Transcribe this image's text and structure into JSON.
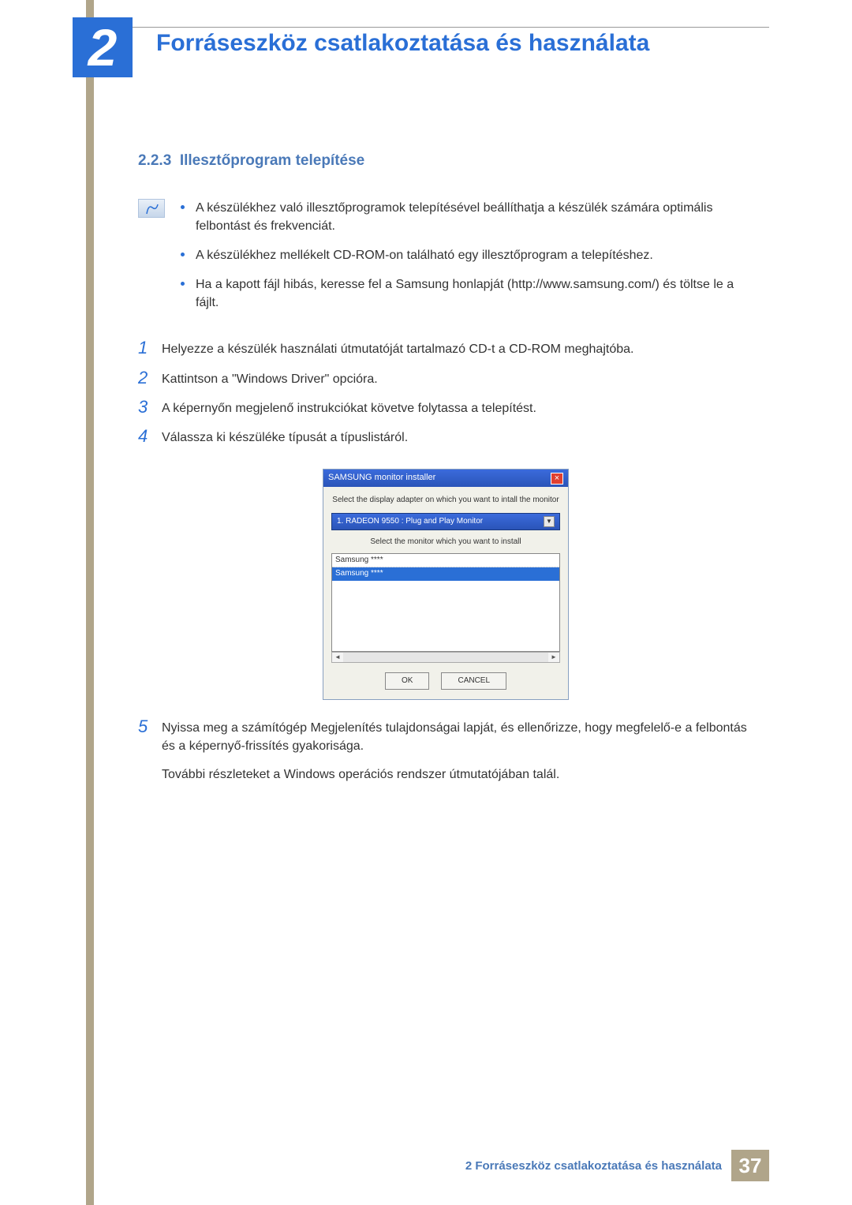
{
  "chapter": {
    "number": "2",
    "title": "Forráseszköz csatlakoztatása és használata"
  },
  "section": {
    "number": "2.2.3",
    "title": "Illesztőprogram telepítése"
  },
  "note_bullets": [
    "A készülékhez való illesztőprogramok telepítésével beállíthatja a készülék számára optimális felbontást és frekvenciát.",
    "A készülékhez mellékelt CD-ROM-on található egy illesztőprogram a telepítéshez.",
    "Ha a kapott fájl hibás, keresse fel a Samsung honlapját (http://www.samsung.com/) és töltse le a fájlt."
  ],
  "steps": [
    {
      "n": "1",
      "text": "Helyezze a készülék használati útmutatóját tartalmazó CD-t a CD-ROM meghajtóba."
    },
    {
      "n": "2",
      "text": "Kattintson a \"Windows Driver\" opcióra."
    },
    {
      "n": "3",
      "text": "A képernyőn megjelenő instrukciókat követve folytassa a telepítést."
    },
    {
      "n": "4",
      "text": "Válassza ki készüléke típusát a típuslistáról."
    },
    {
      "n": "5",
      "text": "Nyissa meg a számítógép Megjelenítés tulajdonságai lapját, és ellenőrizze, hogy megfelelő-e a felbontás és a képernyő-frissítés gyakorisága."
    }
  ],
  "step5_extra": "További részleteket a Windows operációs rendszer útmutatójában talál.",
  "installer": {
    "title": "SAMSUNG monitor installer",
    "label_adapter": "Select the display adapter on which you want to intall the monitor",
    "adapter": "1. RADEON 9550 : Plug and Play Monitor",
    "label_monitor": "Select the monitor which you want to install",
    "list_item1": "Samsung ****",
    "list_item2": "Samsung ****",
    "btn_ok": "OK",
    "btn_cancel": "CANCEL"
  },
  "footer": {
    "text": "2 Forráseszköz csatlakoztatása és használata",
    "page": "37"
  }
}
